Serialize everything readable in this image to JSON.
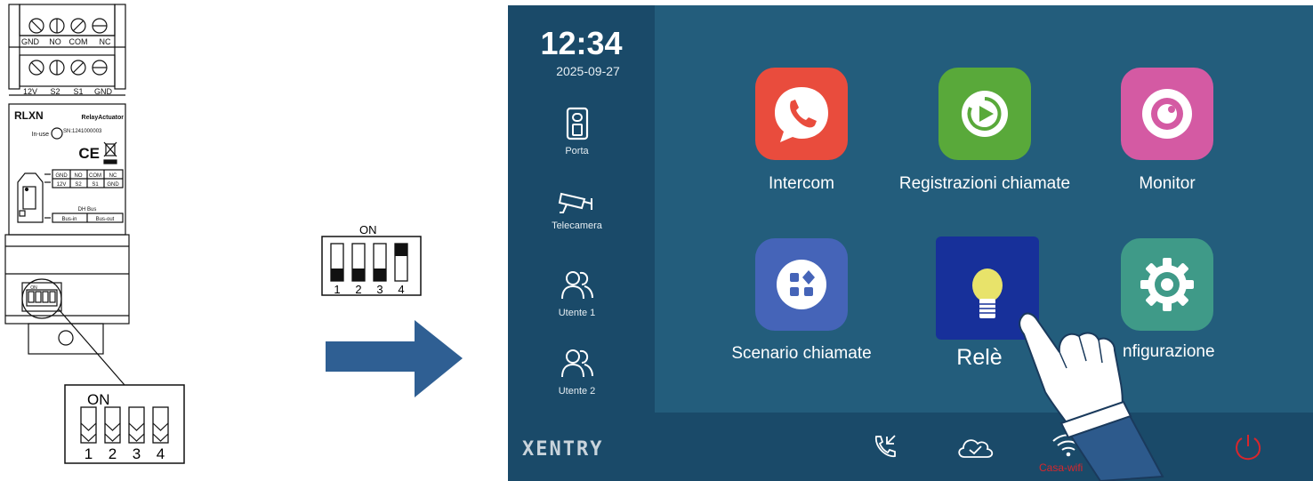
{
  "module": {
    "top_terminals": [
      "GND",
      "NO",
      "COM",
      "NC"
    ],
    "bottom_terminals": [
      "12V",
      "S2",
      "S1",
      "GND"
    ],
    "brand": "RLXN",
    "model": "RelayActuator",
    "in_use_label": "In-use",
    "serial": "SN:1241000003",
    "ce_mark": "CE",
    "wiring_top": [
      "GND",
      "NO",
      "COM",
      "NC"
    ],
    "wiring_bottom": [
      "12V",
      "S2",
      "S1",
      "GND"
    ],
    "bus_title": "DH Bus",
    "bus_in": "Bus-in",
    "bus_out": "Bus-out",
    "dip_small_label": "ON",
    "dip_small_numbers": [
      "1",
      "2",
      "3",
      "4"
    ]
  },
  "dip_default": {
    "label": "ON",
    "numbers": [
      "1",
      "2",
      "3",
      "4"
    ],
    "switch_on": [
      false,
      false,
      false,
      false
    ]
  },
  "dip_set": {
    "label": "ON",
    "numbers": [
      "1",
      "2",
      "3",
      "4"
    ],
    "switch_on": [
      false,
      false,
      false,
      true
    ]
  },
  "arrow": {
    "color": "#2f5f93",
    "icon": "right-arrow-icon"
  },
  "screen": {
    "time": "12:34",
    "date": "2025-09-27",
    "sidebar": [
      {
        "label": "Porta",
        "icon": "door-icon"
      },
      {
        "label": "Telecamera",
        "icon": "camera-icon"
      },
      {
        "label": "Utente 1",
        "icon": "users-icon"
      },
      {
        "label": "Utente 2",
        "icon": "users-icon"
      }
    ],
    "apps": [
      {
        "label": "Intercom",
        "icon": "phone-icon",
        "color": "#e94c3d"
      },
      {
        "label": "Registrazioni chiamate",
        "icon": "playback-icon",
        "color": "#59a93a"
      },
      {
        "label": "Monitor",
        "icon": "eye-icon",
        "color": "#d45aa3"
      },
      {
        "label": "Scenario chiamate",
        "icon": "scene-icon",
        "color": "#4564b8"
      },
      {
        "label": "Relè",
        "icon": "bulb-icon",
        "color": "#17309a"
      },
      {
        "label": "nfigurazione",
        "icon": "gear-icon",
        "color": "#3f9a88"
      }
    ],
    "logo": "XENTRY",
    "wifi_ssid": "Casa-wifi",
    "status_icons": [
      "call-log-icon",
      "cloud-icon",
      "wifi-icon",
      "power-icon"
    ]
  }
}
